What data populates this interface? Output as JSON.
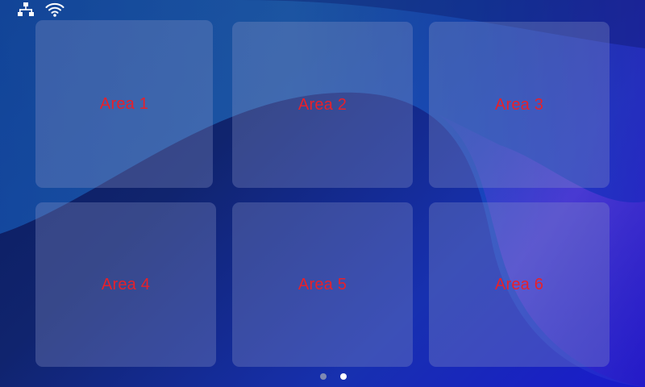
{
  "status_bar": {
    "icons": [
      "network-icon",
      "wifi-icon"
    ],
    "icon_color": "#ffffff"
  },
  "tiles": [
    {
      "label": "Area 1"
    },
    {
      "label": "Area 2"
    },
    {
      "label": "Area 3"
    },
    {
      "label": "Area 4"
    },
    {
      "label": "Area 5"
    },
    {
      "label": "Area 6"
    }
  ],
  "pager": {
    "pages": 2,
    "current_page": 2,
    "active_color": "#ffffff",
    "inactive_color": "#7f89b3"
  },
  "colors": {
    "tile_label": "#e8202a",
    "background_dark": "#0a1a5a",
    "background_accent": "#1a1acc"
  }
}
